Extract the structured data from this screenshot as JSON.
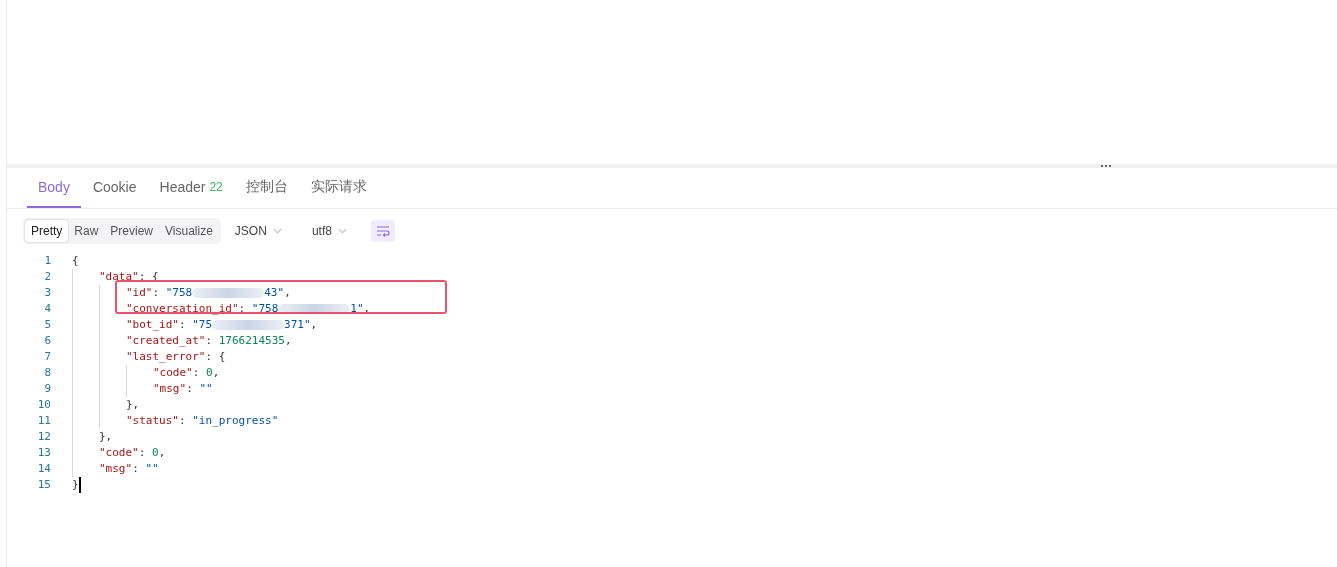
{
  "tabs": [
    {
      "label": "Body",
      "selected": true
    },
    {
      "label": "Cookie",
      "selected": false
    },
    {
      "label": "Header",
      "badge": "22",
      "selected": false
    },
    {
      "label": "控制台",
      "selected": false
    },
    {
      "label": "实际请求",
      "selected": false
    }
  ],
  "view_modes": [
    {
      "label": "Pretty",
      "selected": true
    },
    {
      "label": "Raw",
      "selected": false
    },
    {
      "label": "Preview",
      "selected": false
    },
    {
      "label": "Visualize",
      "selected": false
    }
  ],
  "format_dropdown": {
    "value": "JSON"
  },
  "encoding_dropdown": {
    "value": "utf8"
  },
  "wrap_toggle": {
    "on": true
  },
  "code": [
    {
      "number": "1",
      "tokens": [
        {
          "kind": "punct",
          "text": "{"
        }
      ],
      "children": [
        {
          "number": "2",
          "tokens": [
            {
              "kind": "key",
              "text": "\"data\""
            },
            {
              "kind": "punct",
              "text": ": {"
            }
          ],
          "children": [
            {
              "number": "3",
              "boxed": true,
              "tokens": [
                {
                  "kind": "key",
                  "text": "\"id\""
                },
                {
                  "kind": "punct",
                  "text": ": "
                },
                {
                  "kind": "str",
                  "text": "\"758"
                },
                {
                  "kind": "blur"
                },
                {
                  "kind": "str",
                  "text": "43\""
                },
                {
                  "kind": "punct",
                  "text": ","
                }
              ]
            },
            {
              "number": "4",
              "boxed": true,
              "tokens": [
                {
                  "kind": "key",
                  "text": "\"conversation_id\""
                },
                {
                  "kind": "punct",
                  "text": ": "
                },
                {
                  "kind": "str",
                  "text": "\"758"
                },
                {
                  "kind": "blur"
                },
                {
                  "kind": "str",
                  "text": "1\""
                },
                {
                  "kind": "punct",
                  "text": ","
                }
              ]
            },
            {
              "number": "5",
              "tokens": [
                {
                  "kind": "key",
                  "text": "\"bot_id\""
                },
                {
                  "kind": "punct",
                  "text": ": "
                },
                {
                  "kind": "str",
                  "text": "\"75"
                },
                {
                  "kind": "blur"
                },
                {
                  "kind": "str",
                  "text": "371\""
                },
                {
                  "kind": "punct",
                  "text": ","
                }
              ]
            },
            {
              "number": "6",
              "tokens": [
                {
                  "kind": "key",
                  "text": "\"created_at\""
                },
                {
                  "kind": "punct",
                  "text": ": "
                },
                {
                  "kind": "num",
                  "text": "1766214535"
                },
                {
                  "kind": "punct",
                  "text": ","
                }
              ]
            },
            {
              "number": "7",
              "tokens": [
                {
                  "kind": "key",
                  "text": "\"last_error\""
                },
                {
                  "kind": "punct",
                  "text": ": {"
                }
              ],
              "children": [
                {
                  "number": "8",
                  "tokens": [
                    {
                      "kind": "key",
                      "text": "\"code\""
                    },
                    {
                      "kind": "punct",
                      "text": ": "
                    },
                    {
                      "kind": "num",
                      "text": "0"
                    },
                    {
                      "kind": "punct",
                      "text": ","
                    }
                  ]
                },
                {
                  "number": "9",
                  "tokens": [
                    {
                      "kind": "key",
                      "text": "\"msg\""
                    },
                    {
                      "kind": "punct",
                      "text": ": "
                    },
                    {
                      "kind": "str",
                      "text": "\"\""
                    }
                  ]
                }
              ]
            },
            {
              "number": "10",
              "tokens": [
                {
                  "kind": "punct",
                  "text": "},"
                }
              ]
            },
            {
              "number": "11",
              "tokens": [
                {
                  "kind": "key",
                  "text": "\"status\""
                },
                {
                  "kind": "punct",
                  "text": ": "
                },
                {
                  "kind": "str",
                  "text": "\"in_progress\""
                }
              ]
            }
          ]
        },
        {
          "number": "12",
          "tokens": [
            {
              "kind": "punct",
              "text": "},"
            }
          ]
        },
        {
          "number": "13",
          "tokens": [
            {
              "kind": "key",
              "text": "\"code\""
            },
            {
              "kind": "punct",
              "text": ": "
            },
            {
              "kind": "num",
              "text": "0"
            },
            {
              "kind": "punct",
              "text": ","
            }
          ]
        },
        {
          "number": "14",
          "tokens": [
            {
              "kind": "key",
              "text": "\"msg\""
            },
            {
              "kind": "punct",
              "text": ": "
            },
            {
              "kind": "str",
              "text": "\"\""
            }
          ]
        }
      ]
    },
    {
      "number": "15",
      "cursor": true,
      "tokens": [
        {
          "kind": "punct",
          "text": "}"
        }
      ]
    }
  ]
}
